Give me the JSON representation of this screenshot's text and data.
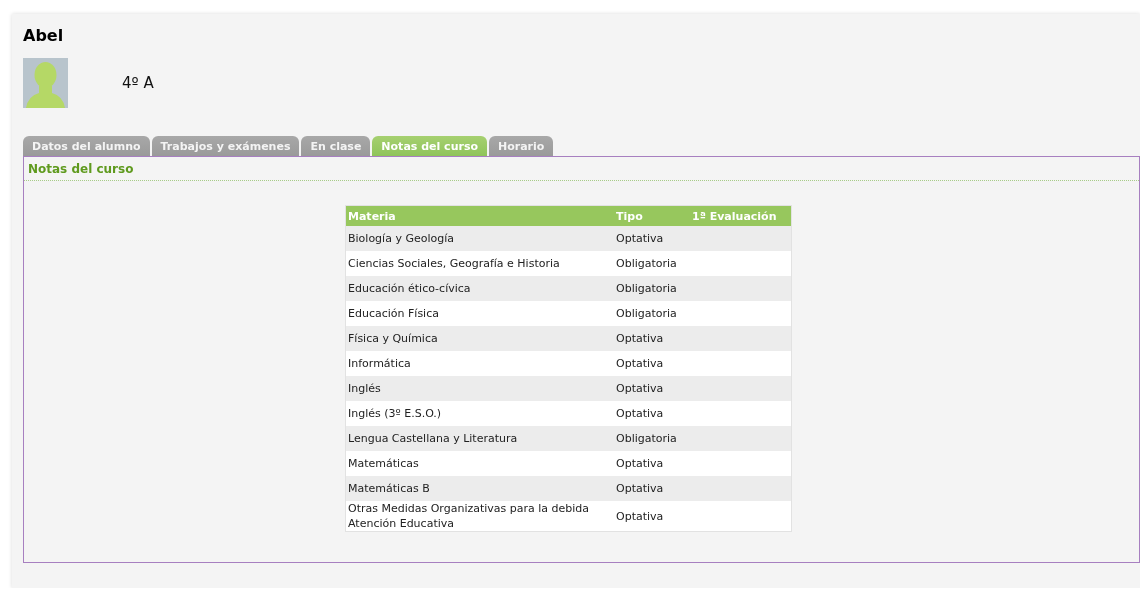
{
  "student": {
    "name": "Abel",
    "group": "4º A"
  },
  "tabs": [
    {
      "label": "Datos del alumno",
      "selected": false
    },
    {
      "label": "Trabajos y exámenes",
      "selected": false
    },
    {
      "label": "En clase",
      "selected": false
    },
    {
      "label": "Notas del curso",
      "selected": true
    },
    {
      "label": "Horario",
      "selected": false
    }
  ],
  "panel": {
    "title": "Notas del curso"
  },
  "table": {
    "columns": [
      "Materia",
      "Tipo",
      "1ª Evaluación"
    ],
    "rows": [
      [
        "Biología y Geología",
        "Optativa"
      ],
      [
        "Ciencias Sociales, Geografía e Historia",
        "Obligatoria"
      ],
      [
        "Educación ético-cívica",
        "Obligatoria"
      ],
      [
        "Educación Física",
        "Obligatoria"
      ],
      [
        "Física y Química",
        "Optativa"
      ],
      [
        "Informática",
        "Optativa"
      ],
      [
        "Inglés",
        "Optativa"
      ],
      [
        "Inglés (3º E.S.O.)",
        "Optativa"
      ],
      [
        "Lengua Castellana y Literatura",
        "Obligatoria"
      ],
      [
        "Matemáticas",
        "Optativa"
      ],
      [
        "Matemáticas B",
        "Optativa"
      ],
      [
        "Otras Medidas Organizativas para la debida Atención Educativa",
        "Optativa"
      ]
    ]
  }
}
